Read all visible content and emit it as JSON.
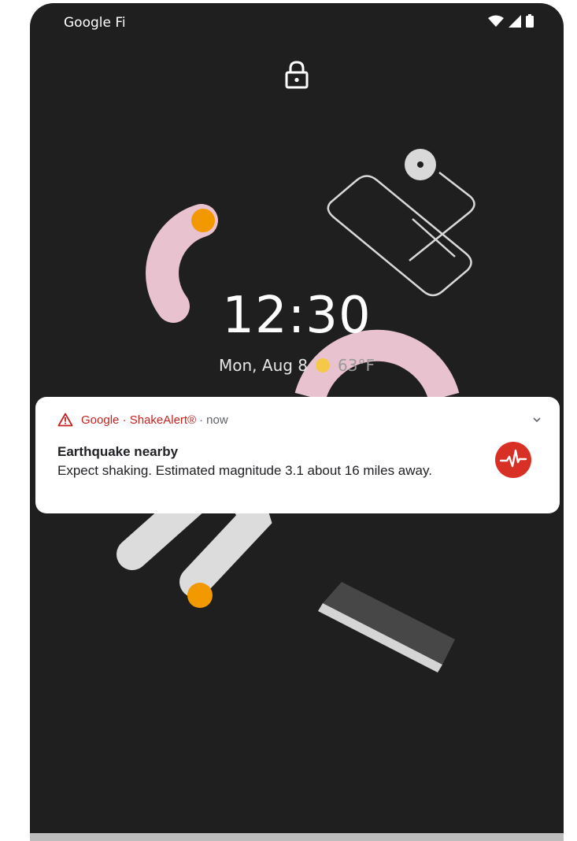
{
  "status_bar": {
    "carrier": "Google Fi",
    "icons": [
      "wifi-icon",
      "cell-signal-icon",
      "battery-icon"
    ]
  },
  "lock_screen": {
    "lock_icon": "lock-icon",
    "time": "12:30",
    "date": "Mon, Aug 8",
    "weather_icon": "sun-icon",
    "temperature": "63°F"
  },
  "notification": {
    "app_icon": "warning-triangle-icon",
    "app_name": "Google · ShakeAlert®",
    "separator": "·",
    "time": "now",
    "title": "Earthquake nearby",
    "body": "Expect shaking. Estimated magnitude 3.1 about 16 miles away.",
    "action_icon": "earthquake-waveform-icon",
    "expand_icon": "chevron-down-icon"
  },
  "colors": {
    "background": "#1f1f1f",
    "alert_red": "#d93025",
    "accent_orange": "#f29900",
    "pink": "#e8c2cf"
  }
}
